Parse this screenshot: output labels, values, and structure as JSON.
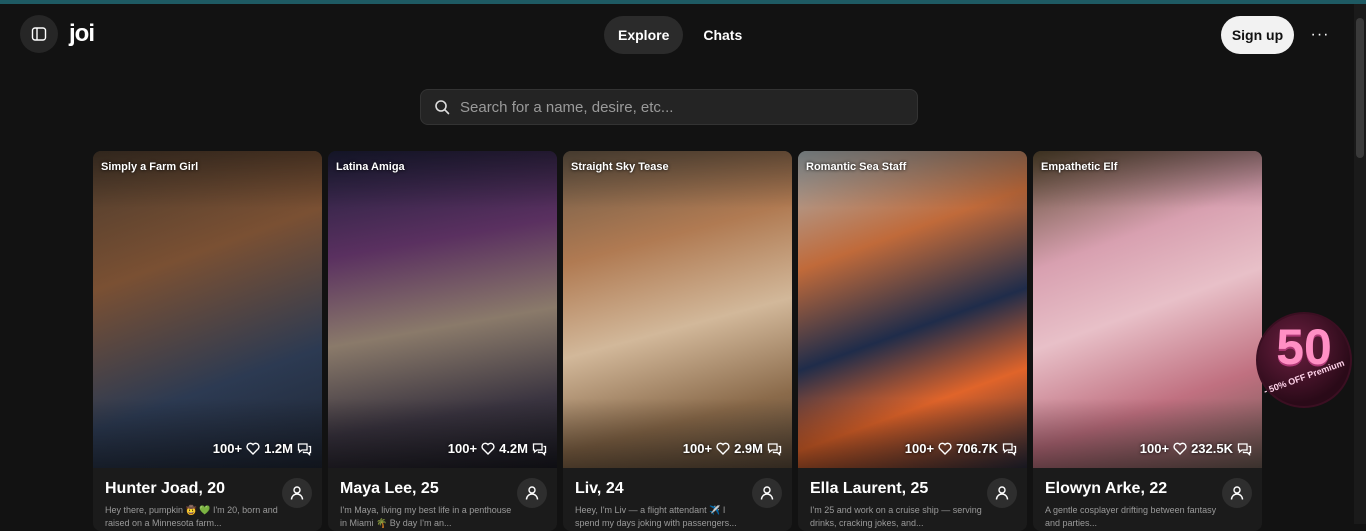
{
  "app": {
    "logo": "joi"
  },
  "nav": {
    "tabs": [
      {
        "label": "Explore",
        "active": true
      },
      {
        "label": "Chats",
        "active": false
      }
    ]
  },
  "header": {
    "signup_label": "Sign up",
    "more_label": "···"
  },
  "search": {
    "placeholder": "Search for a name, desire, etc..."
  },
  "cards": [
    {
      "tag": "Simply a Farm Girl",
      "name": "Hunter Joad, 20",
      "desc": "Hey there, pumpkin 🤠 💚 I'm 20, born and raised on a Minnesota farm...",
      "hearts": "100+",
      "likes": "1.2M"
    },
    {
      "tag": "Latina Amiga",
      "name": "Maya Lee, 25",
      "desc": "I'm Maya, living my best life in a penthouse in Miami 🌴 By day I'm an...",
      "hearts": "100+",
      "likes": "4.2M"
    },
    {
      "tag": "Straight Sky Tease",
      "name": "Liv, 24",
      "desc": "Heey, I'm Liv — a flight attendant ✈️ I spend my days joking with passengers...",
      "hearts": "100+",
      "likes": "2.9M"
    },
    {
      "tag": "Romantic Sea Staff",
      "name": "Ella Laurent, 25",
      "desc": "I'm 25 and work on a cruise ship — serving drinks, cracking jokes, and...",
      "hearts": "100+",
      "likes": "706.7K"
    },
    {
      "tag": "Empathetic Elf",
      "name": "Elowyn Arke, 22",
      "desc": "A gentle cosplayer drifting between fantasy and parties...",
      "hearts": "100+",
      "likes": "232.5K"
    }
  ],
  "promo": {
    "number": "50",
    "text": "- 50% OFF Premium"
  },
  "colors": {
    "background": "#121212",
    "accent_line": "#1e5a63",
    "promo_pink": "#ff8fc4"
  }
}
